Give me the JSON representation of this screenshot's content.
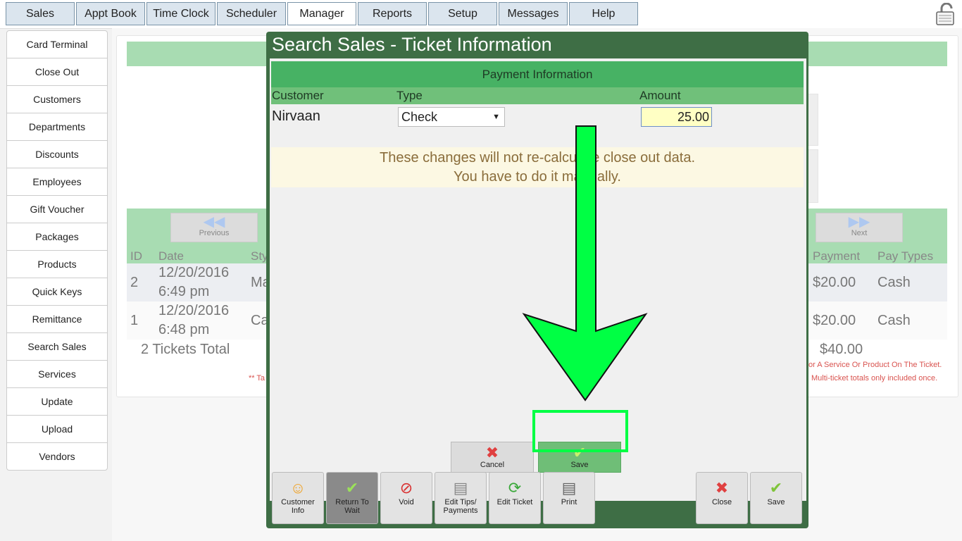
{
  "tabs": [
    "Sales",
    "Appt Book",
    "Time Clock",
    "Scheduler",
    "Manager",
    "Reports",
    "Setup",
    "Messages",
    "Help"
  ],
  "active_tab": "Manager",
  "sidebar": [
    "Card Terminal",
    "Close Out",
    "Customers",
    "Departments",
    "Discounts",
    "Employees",
    "Gift Voucher",
    "Packages",
    "Products",
    "Quick Keys",
    "Remittance",
    "Search Sales",
    "Services",
    "Update",
    "Upload",
    "Vendors"
  ],
  "background": {
    "previous_label": "Previous",
    "next_label": "Next",
    "headers": {
      "id": "ID",
      "date": "Date",
      "style": "Sty",
      "payment": "Payment",
      "pay_types": "Pay Types"
    },
    "rows": [
      {
        "id": "2",
        "date": "12/20/2016",
        "time": "6:49 pm",
        "style": "Ma",
        "payment": "$20.00",
        "pay_type": "Cash"
      },
      {
        "id": "1",
        "date": "12/20/2016",
        "time": "6:48 pm",
        "style": "Ca",
        "payment": "$20.00",
        "pay_type": "Cash"
      }
    ],
    "total_label": "2 Tickets Total",
    "total_amount": "$40.00",
    "note_left": "** Ta",
    "note_right_1": "or A Service Or Product On The Ticket.",
    "note_right_2": "Multi-ticket totals only included once."
  },
  "modal": {
    "title": "Search Sales - Ticket Information",
    "payment_header": "Payment Information",
    "columns": {
      "customer": "Customer",
      "type": "Type",
      "amount": "Amount"
    },
    "customer": "Nirvaan",
    "type": "Check",
    "amount": "25.00",
    "warning_1": "These changes will not re-calculate close out data.",
    "warning_2": "You have to do it manually.",
    "cancel_label": "Cancel",
    "save_label": "Save"
  },
  "toolbar": {
    "customer_info": [
      "Customer",
      "Info"
    ],
    "return_to_wait": [
      "Return To",
      "Wait"
    ],
    "void": "Void",
    "edit_tips": [
      "Edit Tips/",
      "Payments"
    ],
    "edit_ticket": "Edit Ticket",
    "print": "Print",
    "close": "Close",
    "save": "Save"
  },
  "colors": {
    "modal_green": "#3e6e45",
    "header_green": "#47b264",
    "callout_arrow": "#00ff44"
  }
}
